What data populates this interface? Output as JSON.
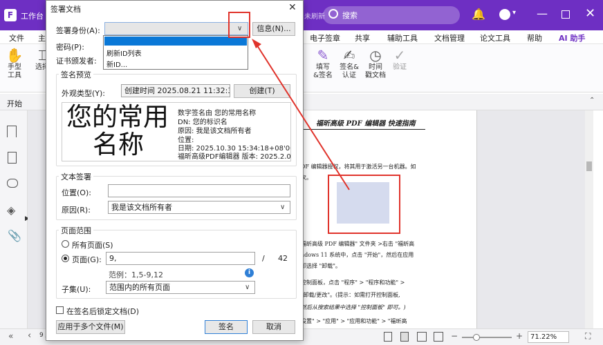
{
  "titlebar": {
    "tab": "工作台",
    "search_placeholder": "搜索",
    "hint": "未刷新"
  },
  "menu": [
    "文件",
    "主页",
    "电子签章",
    "共享",
    "辅助工具",
    "文档管理",
    "论文工具",
    "帮助",
    "AI 助手"
  ],
  "ribbon": {
    "hand_label": "手型\n工具",
    "select_label": "选择",
    "fill_sign": "填写\n&签名",
    "sign_auth": "签名&\n认证",
    "timestamp": "时间\n戳文档",
    "verify": "验证"
  },
  "tabstrip": {
    "tab": "开始"
  },
  "status": {
    "page_value": "9 / 42",
    "zoom": "71.22%"
  },
  "document": {
    "header": "福昕高级 PDF 编辑器 快速指南",
    "lines": [
      "DF 编辑器授权，将其用于激活另一台机器。如",
      "次。",
      "福昕高级 PDF 编辑器\" 文件夹 >右击 \"福昕高",
      "ndows 11 系统中，点击 \"开始\"，然后在应用",
      "卸选择 \"卸载\"。",
      "控制面板，点击 \"程序\" > \"程序和功能\" >",
      "\"卸载/更改\"。(提示：如需打开控制面板,",
      "然后从搜索结果中选择 \"控制面板\" 即可。)",
      "设置\" > \"应用\" > \"应用和功能\" > \"福昕高"
    ]
  },
  "dialog": {
    "title": "签署文档",
    "identity_label": "签署身份(A):",
    "info_button": "信息(N)...",
    "password_label": "密码(P):",
    "issuer_label": "证书颁发者:",
    "dropdown_items": [
      "刷新ID列表",
      "新ID..."
    ],
    "preview_group": "签名预览",
    "appearance_label": "外观类型(Y):",
    "appearance_value": "创建时间 2025.08.21 11:32:35",
    "create_button": "创建(T)",
    "preview_big": [
      "您的常用",
      "名称"
    ],
    "preview_details": [
      "数字签名由 您的常用名称",
      "DN:   您的标识名",
      "原因:   我是该文档所有者",
      "位置:",
      "日期:   2025.10.30 15:34:18+08'00'",
      "福昕高级PDF编辑器 版本: 2025.2.0"
    ],
    "text_sign_group": "文本签署",
    "location_label": "位置(O):",
    "location_value": "",
    "reason_label": "原因(R):",
    "reason_value": "我是该文档所有者",
    "range_group": "页面范围",
    "all_pages_label": "所有页面(S)",
    "page_label": "页面(G):",
    "page_value": "9,",
    "page_total_sep": "/",
    "page_total": "42",
    "range_hint": "范例：1,5-9,12",
    "subset_label": "子集(U):",
    "subset_value": "范围内的所有页面",
    "lock_label": "在签名后锁定文档(D)",
    "apply_multi_button": "应用于多个文件(M)",
    "sign_button": "签名",
    "cancel_button": "取消"
  },
  "colors": {
    "brand": "#6e2fc3",
    "highlight": "#e0332b",
    "selection": "#0a78d7"
  }
}
